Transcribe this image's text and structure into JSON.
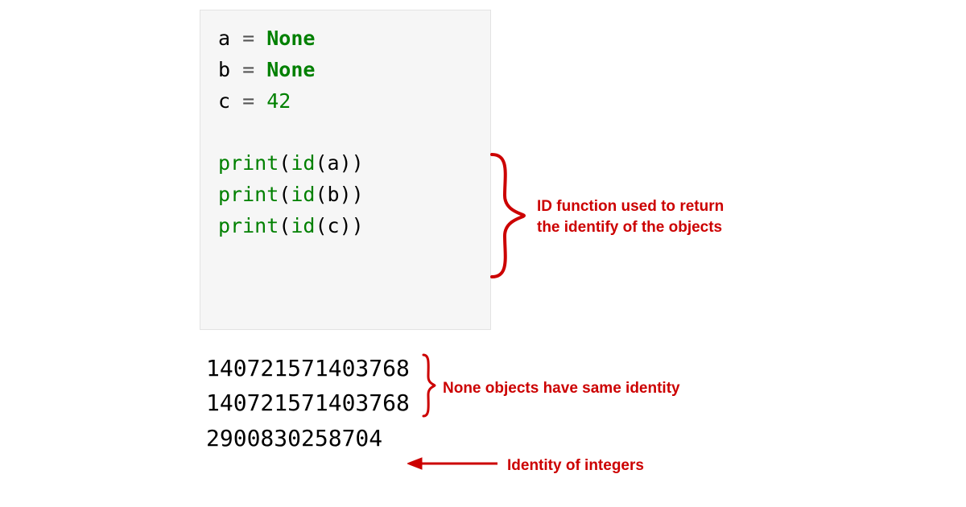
{
  "code": {
    "line1": {
      "var": "a",
      "op": " = ",
      "val": "None"
    },
    "line2": {
      "var": "b",
      "op": " = ",
      "val": "None"
    },
    "line3": {
      "var": "c",
      "op": " = ",
      "val": "42"
    },
    "line4": "",
    "line5": {
      "fn": "print",
      "lp": "(",
      "id": "id",
      "lp2": "(",
      "arg": "a",
      "rp2": ")",
      "rp": ")"
    },
    "line6": {
      "fn": "print",
      "lp": "(",
      "id": "id",
      "lp2": "(",
      "arg": "b",
      "rp2": ")",
      "rp": ")"
    },
    "line7": {
      "fn": "print",
      "lp": "(",
      "id": "id",
      "lp2": "(",
      "arg": "c",
      "rp2": ")",
      "rp": ")"
    }
  },
  "output": {
    "line1": "140721571403768",
    "line2": "140721571403768",
    "line3": "2900830258704"
  },
  "annotations": {
    "id_fn_line1": "ID function used to return",
    "id_fn_line2": "the identify of the objects",
    "none_identity": "None objects have same identity",
    "int_identity": "Identity of integers"
  },
  "colors": {
    "annotation": "#cc0000",
    "keyword": "#008000",
    "code_bg": "#f6f6f6"
  }
}
